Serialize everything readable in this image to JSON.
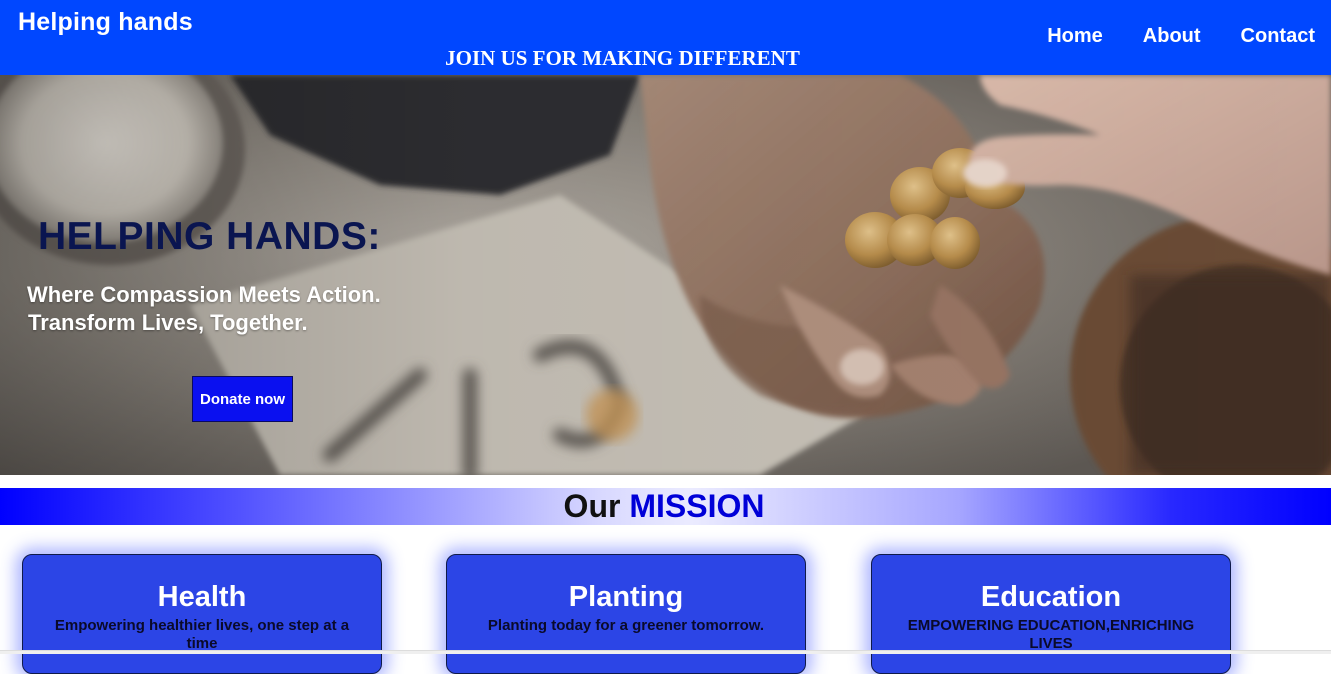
{
  "header": {
    "brand": "Helping hands",
    "tagline": "JOIN US FOR MAKING DIFFERENT",
    "nav": [
      {
        "label": "Home"
      },
      {
        "label": "About"
      },
      {
        "label": "Contact"
      }
    ],
    "color": "#0047ff"
  },
  "hero": {
    "title": "HELPING HANDS:",
    "subtitle_line1": "Where Compassion Meets Action.",
    "subtitle_line2": "Transform Lives, Together.",
    "donate_label": "Donate now",
    "image_subject": "hands-holding-coins-help-sign"
  },
  "mission": {
    "title_plain": "Our",
    "title_accent": "MISSION",
    "cards": [
      {
        "title": "Health",
        "text": "Empowering healthier lives, one step at a time"
      },
      {
        "title": "Planting",
        "text": "Planting today for a greener tomorrow."
      },
      {
        "title": "Education",
        "text": "EMPOWERING EDUCATION,ENRICHING LIVES"
      }
    ]
  },
  "colors": {
    "nav_blue": "#0047ff",
    "button_blue": "#0a10f0",
    "card_blue": "#2c45e6",
    "mission_accent": "#0000d8"
  }
}
